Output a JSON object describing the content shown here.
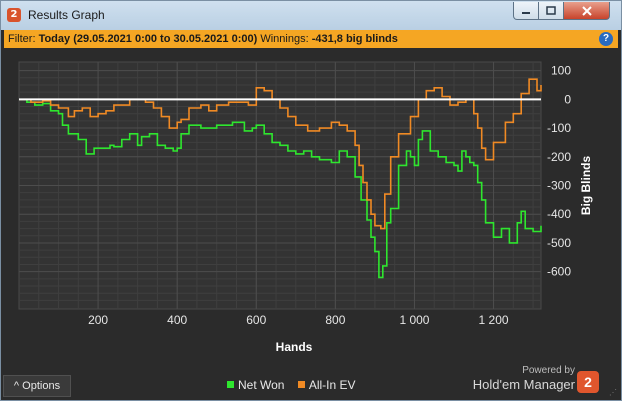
{
  "window": {
    "title": "Results Graph",
    "app_icon": "2"
  },
  "filter": {
    "label": "Filter:",
    "value": "Today (29.05.2021 0:00 to 30.05.2021 0:00)",
    "winnings_label": "Winnings:",
    "winnings_value": "-431,8 big blinds",
    "help": "?"
  },
  "footer": {
    "options_label": "Options",
    "powered_by": "Powered by",
    "brand": "Hold'em Manager",
    "brand_badge": "2"
  },
  "colors": {
    "net_won": "#2ee62e",
    "all_in_ev": "#f08a24",
    "zero_line": "#ffffff",
    "filter_bg": "#f5a623",
    "panel_bg": "#2b2b2b"
  },
  "chart_data": {
    "type": "line",
    "xlabel": "Hands",
    "ylabel": "Big Blinds",
    "xlim": [
      0,
      1320
    ],
    "ylim": [
      -730,
      130
    ],
    "xticks": [
      "200",
      "400",
      "600",
      "800",
      "1 000",
      "1 200"
    ],
    "xtick_values": [
      200,
      400,
      600,
      800,
      1000,
      1200
    ],
    "yticks": [
      "100",
      "0",
      "-100",
      "-200",
      "-300",
      "-400",
      "-500",
      "-600"
    ],
    "ytick_values": [
      100,
      0,
      -100,
      -200,
      -300,
      -400,
      -500,
      -600
    ],
    "grid": true,
    "legend_position": "bottom-center",
    "series": [
      {
        "name": "Net Won",
        "color": "#2ee62e",
        "x": [
          0,
          20,
          40,
          60,
          80,
          100,
          110,
          125,
          150,
          170,
          190,
          210,
          230,
          240,
          260,
          280,
          300,
          310,
          330,
          350,
          370,
          390,
          400,
          410,
          430,
          460,
          480,
          500,
          540,
          570,
          590,
          600,
          620,
          640,
          660,
          680,
          700,
          720,
          740,
          760,
          790,
          810,
          830,
          850,
          865,
          880,
          890,
          900,
          910,
          920,
          930,
          940,
          960,
          980,
          990,
          1000,
          1010,
          1020,
          1040,
          1060,
          1080,
          1100,
          1110,
          1120,
          1130,
          1140,
          1150,
          1160,
          1170,
          1180,
          1200,
          1220,
          1240,
          1260,
          1270,
          1280,
          1300,
          1320
        ],
        "y": [
          0,
          -10,
          -20,
          -15,
          -40,
          -50,
          -90,
          -120,
          -140,
          -190,
          -170,
          -170,
          -160,
          -165,
          -140,
          -120,
          -160,
          -130,
          -120,
          -160,
          -170,
          -180,
          -170,
          -120,
          -90,
          -100,
          -100,
          -90,
          -80,
          -110,
          -100,
          -90,
          -120,
          -150,
          -160,
          -180,
          -190,
          -180,
          -200,
          -210,
          -220,
          -180,
          -200,
          -270,
          -350,
          -420,
          -480,
          -530,
          -620,
          -580,
          -430,
          -380,
          -230,
          -180,
          -200,
          -230,
          -140,
          -110,
          -180,
          -200,
          -220,
          -230,
          -250,
          -180,
          -200,
          -220,
          -230,
          -290,
          -350,
          -430,
          -480,
          -450,
          -500,
          -430,
          -390,
          -450,
          -460,
          -440
        ]
      },
      {
        "name": "All-In EV",
        "color": "#f08a24",
        "x": [
          0,
          30,
          60,
          80,
          100,
          110,
          125,
          140,
          160,
          180,
          200,
          220,
          240,
          260,
          280,
          300,
          320,
          340,
          360,
          380,
          400,
          410,
          430,
          460,
          480,
          500,
          530,
          560,
          580,
          600,
          620,
          640,
          660,
          680,
          700,
          730,
          760,
          790,
          810,
          830,
          850,
          860,
          870,
          880,
          890,
          900,
          915,
          925,
          940,
          960,
          990,
          1010,
          1030,
          1050,
          1070,
          1090,
          1110,
          1130,
          1150,
          1160,
          1170,
          1180,
          1200,
          1230,
          1250,
          1270,
          1290,
          1310,
          1320
        ],
        "y": [
          0,
          -10,
          -5,
          -20,
          -30,
          -30,
          -60,
          -40,
          -30,
          -60,
          -50,
          -40,
          -20,
          -20,
          0,
          0,
          -10,
          -30,
          -60,
          -100,
          -80,
          -70,
          -30,
          -20,
          -40,
          -20,
          -10,
          -10,
          -20,
          40,
          30,
          0,
          -30,
          -60,
          -90,
          -110,
          -100,
          -80,
          -90,
          -110,
          -160,
          -230,
          -290,
          -350,
          -400,
          -440,
          -450,
          -330,
          -200,
          -120,
          -60,
          0,
          30,
          40,
          10,
          -20,
          -10,
          0,
          -50,
          -100,
          -170,
          -210,
          -150,
          -80,
          -50,
          20,
          70,
          30,
          50
        ]
      }
    ]
  }
}
